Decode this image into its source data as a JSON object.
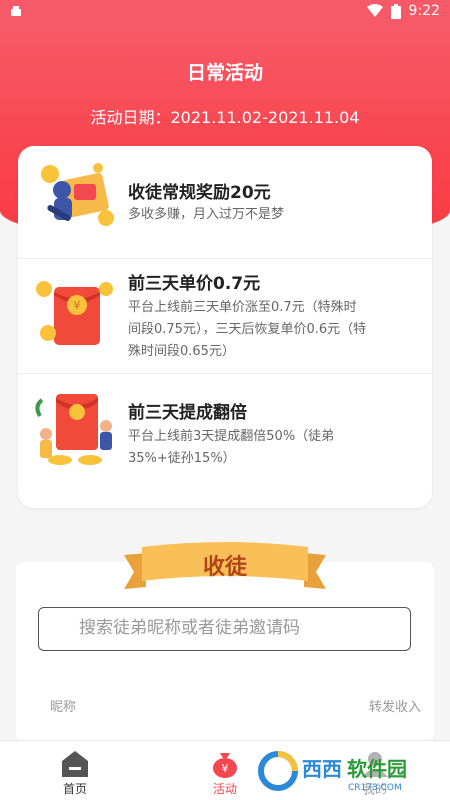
{
  "status_bar": {
    "time": "9:22"
  },
  "header": {
    "title": "日常活动",
    "date_label": "活动日期：2021.11.02-2021.11.04"
  },
  "activities": [
    {
      "title": "收徒常规奖励20元",
      "desc": "多收多赚，月入过万不是梦",
      "icon": "recruit-reward-illustration"
    },
    {
      "title": "前三天单价0.7元",
      "desc": "平台上线前三天单价涨至0.7元（特殊时间段0.75元），三天后恢复单价0.6元（特殊时间段0.65元）",
      "icon": "red-envelope-coins-illustration"
    },
    {
      "title": "前三天提成翻倍",
      "desc": "平台上线前3天提成翻倍50%（徒弟35%+徒孙15%）",
      "icon": "celebration-red-envelope-illustration"
    }
  ],
  "recruit": {
    "banner_label": "收徒",
    "search_placeholder": "搜索徒弟昵称或者徒弟邀请码",
    "col_nickname": "昵称",
    "col_income": "转发收入"
  },
  "nav": [
    {
      "label": "首页",
      "icon": "home-icon",
      "active": false
    },
    {
      "label": "活动",
      "icon": "money-bag-icon",
      "active": true
    },
    {
      "label": "我的",
      "icon": "profile-icon",
      "active": false
    }
  ],
  "watermark": {
    "brand_text": "西西软件园",
    "url_text": "CR173.COM"
  },
  "colors": {
    "primary": "#f65a68",
    "accent": "#f34850",
    "ribbon": "#f6b94a"
  }
}
